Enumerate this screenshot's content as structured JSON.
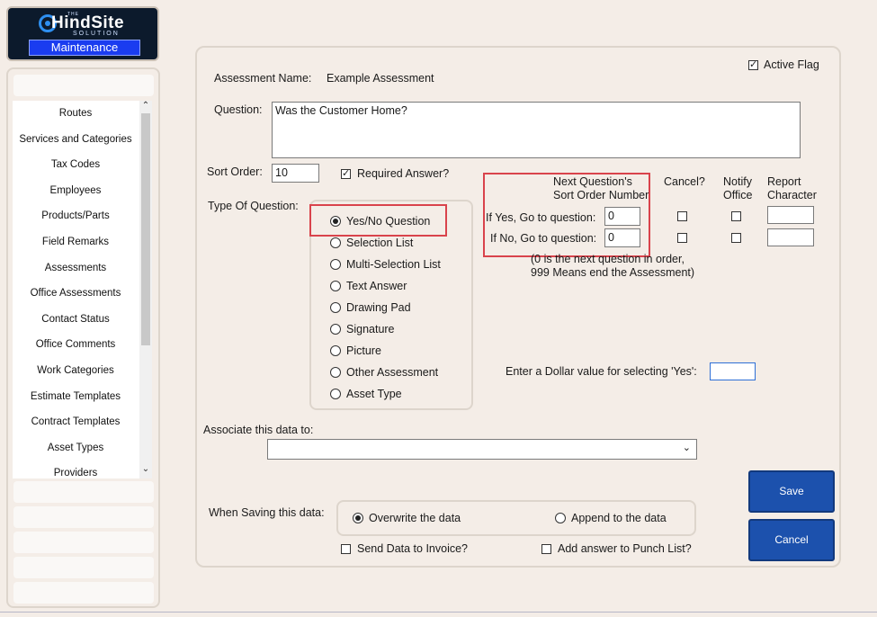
{
  "logo": {
    "top_text": "THE",
    "brand": "HindSite",
    "sub": "SOLUTION",
    "section": "Maintenance"
  },
  "sidebar": {
    "items": [
      "Routes",
      "Services and Categories",
      "Tax Codes",
      "Employees",
      "Products/Parts",
      "Field Remarks",
      "Assessments",
      "Office Assessments",
      "Contact Status",
      "Office Comments",
      "Work Categories",
      "Estimate Templates",
      "Contract Templates",
      "Asset Types",
      "Providers"
    ],
    "scroll_up": "⌃",
    "scroll_down": "⌄"
  },
  "form": {
    "active_flag_label": "Active Flag",
    "active_flag_checked": true,
    "assessment_name_label": "Assessment Name:",
    "assessment_name_value": "Example Assessment",
    "question_label": "Question:",
    "question_value": "Was the Customer Home?",
    "sort_order_label": "Sort Order:",
    "sort_order_value": "10",
    "required_answer_label": "Required Answer?",
    "required_answer_checked": true,
    "type_label": "Type Of Question:",
    "types": [
      "Yes/No Question",
      "Selection List",
      "Multi-Selection List",
      "Text Answer",
      "Drawing Pad",
      "Signature",
      "Picture",
      "Other Assessment",
      "Asset Type"
    ],
    "selected_type": "Yes/No Question",
    "next_q_header_1": "Next Question's",
    "next_q_header_2": "Sort Order Number",
    "cancel_header": "Cancel?",
    "notify_header_1": "Notify",
    "notify_header_2": "Office",
    "report_header_1": "Report",
    "report_header_2": "Character",
    "if_yes_label": "If Yes, Go to question:",
    "if_yes_value": "0",
    "if_no_label": "If No, Go to question:",
    "if_no_value": "0",
    "note_1": "(0 is the next question in order,",
    "note_2": "999 Means end the Assessment)",
    "dollar_label": "Enter a Dollar value for selecting 'Yes':",
    "dollar_value": "",
    "associate_label": "Associate this data to:",
    "associate_value": "",
    "when_saving_label": "When Saving this data:",
    "overwrite_label": "Overwrite the data",
    "append_label": "Append to the data",
    "save_mode": "overwrite",
    "send_invoice_label": "Send Data to Invoice?",
    "punch_list_label": "Add answer to Punch List?",
    "save_label": "Save",
    "cancel_label": "Cancel"
  },
  "colors": {
    "background": "#f4ede7",
    "button": "#1c51ad",
    "highlight": "#d9434c"
  }
}
